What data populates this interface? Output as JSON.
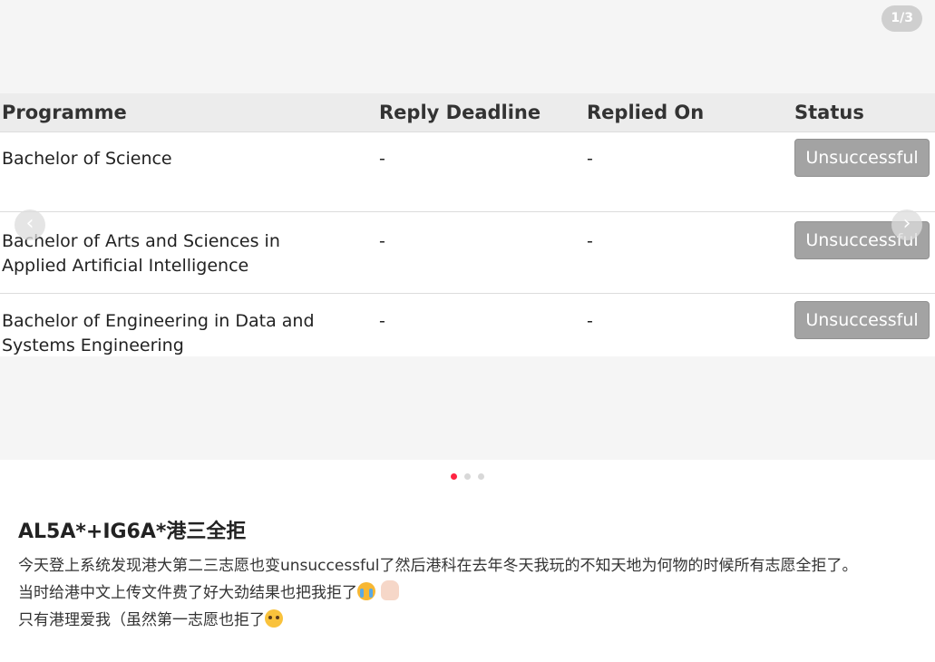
{
  "carousel": {
    "counter": "1/3",
    "prev_arrow": "‹",
    "next_arrow": "›",
    "table": {
      "headers": [
        "Programme",
        "Reply Deadline",
        "Replied On",
        "Status"
      ],
      "rows": [
        {
          "programme": "Bachelor of Science",
          "deadline": "-",
          "replied_on": "-",
          "status": "Unsuccessful"
        },
        {
          "programme": "Bachelor of Arts and Sciences in Applied Artificial Intelligence",
          "deadline": "-",
          "replied_on": "-",
          "status": "Unsuccessful"
        },
        {
          "programme": "Bachelor of Engineering in Data and Systems Engineering",
          "deadline": "-",
          "replied_on": "-",
          "status": "Unsuccessful"
        }
      ]
    },
    "dots": {
      "count": 3,
      "active_index": 0,
      "active_color": "#ff2442"
    }
  },
  "post": {
    "title": "AL5A*+IG6A*港三全拒",
    "lines": [
      "今天登上系统发现港大第二三志愿也变unsuccessful了然后港科在去年冬天我玩的不知天地为何物的时候所有志愿全拒了。",
      "当时给港中文上传文件费了好大劲结果也把我拒了",
      "只有港理爱我（虽然第一志愿也拒了"
    ],
    "emojis": [
      "crying-face-icon",
      "raised-hand-icon",
      "pleading-face-icon"
    ]
  }
}
